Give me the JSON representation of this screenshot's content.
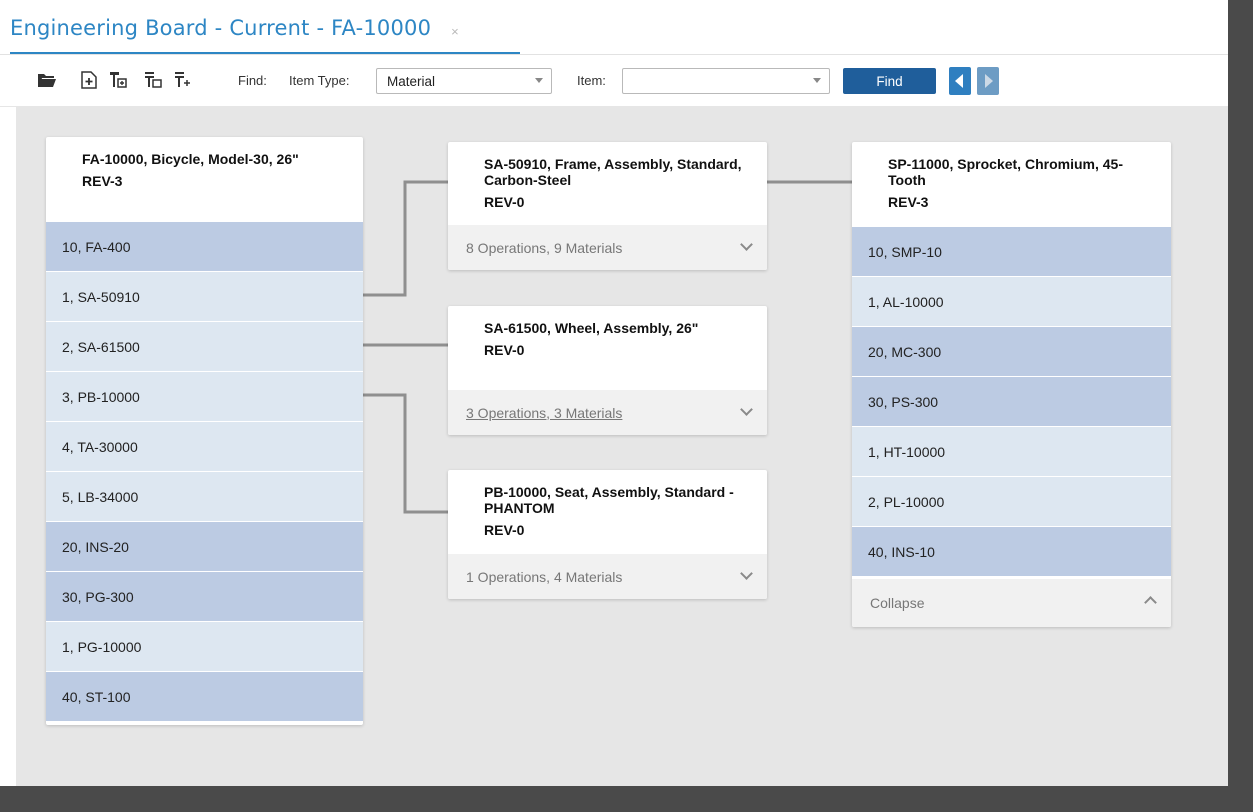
{
  "tab": {
    "title": "Engineering Board - Current - FA-10000",
    "close": "×"
  },
  "toolbar": {
    "icons": [
      "open-folder-icon",
      "add-item-icon",
      "tree-add-icon",
      "tree-edit-icon",
      "tree-expand-icon"
    ],
    "find_label": "Find:",
    "item_type_label": "Item Type:",
    "item_type_value": "Material",
    "item_label": "Item:",
    "item_value": "",
    "find_button": "Find",
    "accent": "#2d86c4",
    "button_color": "#1f5e9b"
  },
  "board": {
    "parent": {
      "title": "FA-10000, Bicycle, Model-30, 26\"",
      "rev": "REV-3",
      "rows": [
        {
          "label": "10, FA-400",
          "shade": "dark"
        },
        {
          "label": "1, SA-50910",
          "shade": "light"
        },
        {
          "label": "2, SA-61500",
          "shade": "light"
        },
        {
          "label": "3, PB-10000",
          "shade": "light"
        },
        {
          "label": "4, TA-30000",
          "shade": "light"
        },
        {
          "label": "5, LB-34000",
          "shade": "light"
        },
        {
          "label": "20, INS-20",
          "shade": "dark"
        },
        {
          "label": "30, PG-300",
          "shade": "dark"
        },
        {
          "label": "1, PG-10000",
          "shade": "light"
        },
        {
          "label": "40, ST-100",
          "shade": "dark"
        }
      ]
    },
    "middle": [
      {
        "title": "SA-50910, Frame, Assembly, Standard, Carbon-Steel",
        "rev": "REV-0",
        "summary": "8 Operations, 9 Materials"
      },
      {
        "title": "SA-61500, Wheel, Assembly, 26\"",
        "rev": "REV-0",
        "summary": "3 Operations, 3 Materials"
      },
      {
        "title": "PB-10000, Seat, Assembly, Standard - PHANTOM",
        "rev": "REV-0",
        "summary": "1 Operations, 4 Materials"
      }
    ],
    "right": {
      "title": "SP-11000, Sprocket, Chromium, 45-Tooth",
      "rev": "REV-3",
      "rows": [
        {
          "label": "10, SMP-10",
          "shade": "dark"
        },
        {
          "label": "1, AL-10000",
          "shade": "light"
        },
        {
          "label": "20, MC-300",
          "shade": "dark"
        },
        {
          "label": "30, PS-300",
          "shade": "dark"
        },
        {
          "label": "1, HT-10000",
          "shade": "light"
        },
        {
          "label": "2, PL-10000",
          "shade": "light"
        },
        {
          "label": "40, INS-10",
          "shade": "dark"
        }
      ],
      "collapse": "Collapse"
    },
    "colors": {
      "row_dark": "#bccbe3",
      "row_light": "#dde7f1",
      "connector": "#8f8f8f",
      "canvas": "#e6e6e6"
    }
  }
}
